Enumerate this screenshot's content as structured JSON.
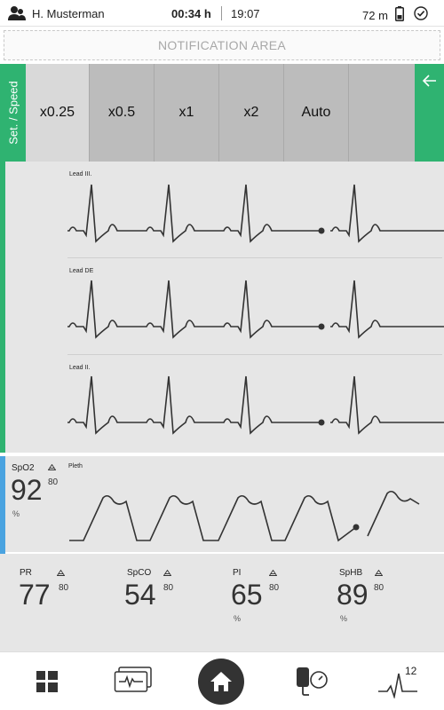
{
  "status": {
    "user": "H. Musterman",
    "elapsed": "00:34 h",
    "time": "19:07",
    "remaining": "72 m"
  },
  "notification": "NOTIFICATION AREA",
  "speed": {
    "title": "Set. / Speed",
    "options": [
      "x0.25",
      "x0.5",
      "x1",
      "x2",
      "Auto"
    ],
    "selected": "x0.25"
  },
  "ecg": {
    "leads": [
      "Lead III.",
      "Lead DE",
      "Lead II."
    ]
  },
  "spo2": {
    "name": "SpO2",
    "value": "92",
    "limit": "80",
    "unit": "%",
    "wave_label": "Pleth"
  },
  "params": [
    {
      "name": "PR",
      "value": "77",
      "limit": "80",
      "unit": ""
    },
    {
      "name": "SpCO",
      "value": "54",
      "limit": "80",
      "unit": ""
    },
    {
      "name": "PI",
      "value": "65",
      "limit": "80",
      "unit": "%"
    },
    {
      "name": "SpHB",
      "value": "89",
      "limit": "80",
      "unit": "%"
    }
  ],
  "nav": {
    "lead_count": "12"
  },
  "colors": {
    "accent_green": "#2fb371",
    "accent_blue": "#4aa3e0",
    "wave": "#333333"
  },
  "icons": [
    "user-group-icon",
    "battery-icon",
    "check-circle-icon",
    "back-arrow-icon",
    "alarm-bell-icon",
    "dashboard-icon",
    "monitor-wave-icon",
    "home-icon",
    "blood-pressure-icon",
    "ecg-leads-icon"
  ]
}
